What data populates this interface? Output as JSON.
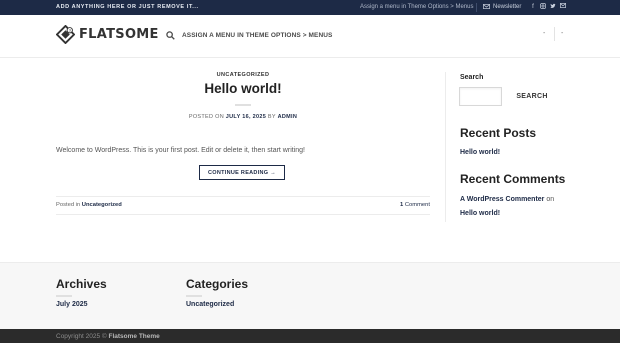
{
  "topbar": {
    "left_text": "ADD ANYTHING HERE OR JUST REMOVE IT...",
    "menu_note": "Assign a menu in Theme Options > Menus",
    "newsletter": "Newsletter",
    "social_icons": [
      "facebook-icon",
      "instagram-icon",
      "twitter-icon",
      "email-icon"
    ]
  },
  "header": {
    "logo_text": "FLATSOME",
    "nav_text": "ASSIGN A MENU IN THEME OPTIONS > MENUS",
    "dash_left": "-",
    "dash_right": "-"
  },
  "post": {
    "category": "UNCATEGORIZED",
    "title": "Hello world!",
    "posted_on_prefix": "POSTED ON",
    "date": "JULY 16, 2025",
    "by": "BY",
    "author": "ADMIN",
    "excerpt": "Welcome to WordPress. This is your first post. Edit or delete it, then start writing!",
    "continue_label": "CONTINUE READING →",
    "posted_in_prefix": "Posted in",
    "posted_in_category": "Uncategorized",
    "comments_count": "1",
    "comments_label": "Comment"
  },
  "sidebar": {
    "search_label": "Search",
    "search_value": "",
    "search_button": "SEARCH",
    "recent_posts_heading": "Recent Posts",
    "recent_posts": [
      "Hello world!"
    ],
    "recent_comments_heading": "Recent Comments",
    "comment_author": "A WordPress Commenter",
    "comment_on": "on",
    "comment_post": "Hello world!"
  },
  "footer_widgets": {
    "archives_heading": "Archives",
    "archives": [
      "July 2025"
    ],
    "categories_heading": "Categories",
    "categories": [
      "Uncategorized"
    ]
  },
  "footer": {
    "copyright_prefix": "Copyright 2025 ©",
    "theme_name": "Flatsome Theme"
  },
  "colors": {
    "brand_navy": "#1d2a46",
    "footer_dark": "#2b2b2b"
  }
}
